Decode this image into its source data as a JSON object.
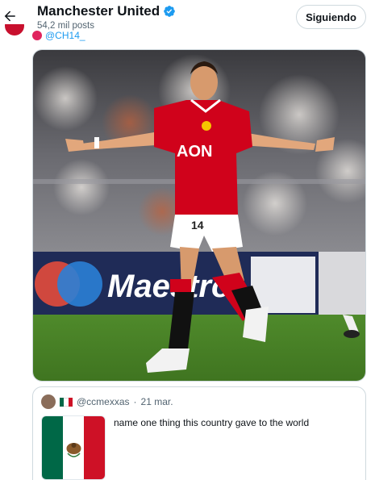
{
  "header": {
    "title": "Manchester United",
    "subtitle": "54,2 mil posts",
    "follow_label": "Siguiendo"
  },
  "tweet": {
    "handle": "@CH14_"
  },
  "media": {
    "alt": "Footballer in red shirt celebrating with arms spread",
    "sponsor": "AON",
    "number": "14",
    "board_text": "Maestro"
  },
  "quote": {
    "handle": "@ccmexxas",
    "separator": "·",
    "date": "21 mar.",
    "text": "name one thing this country gave to the world"
  },
  "colors": {
    "verified": "#1d9bf0",
    "kit_red": "#d0021b",
    "pitch": "#4f8a2b",
    "mexico_green": "#006847",
    "mexico_red": "#ce1126"
  },
  "icons": {
    "back": "arrow-left-icon",
    "verified": "verified-badge-icon"
  }
}
